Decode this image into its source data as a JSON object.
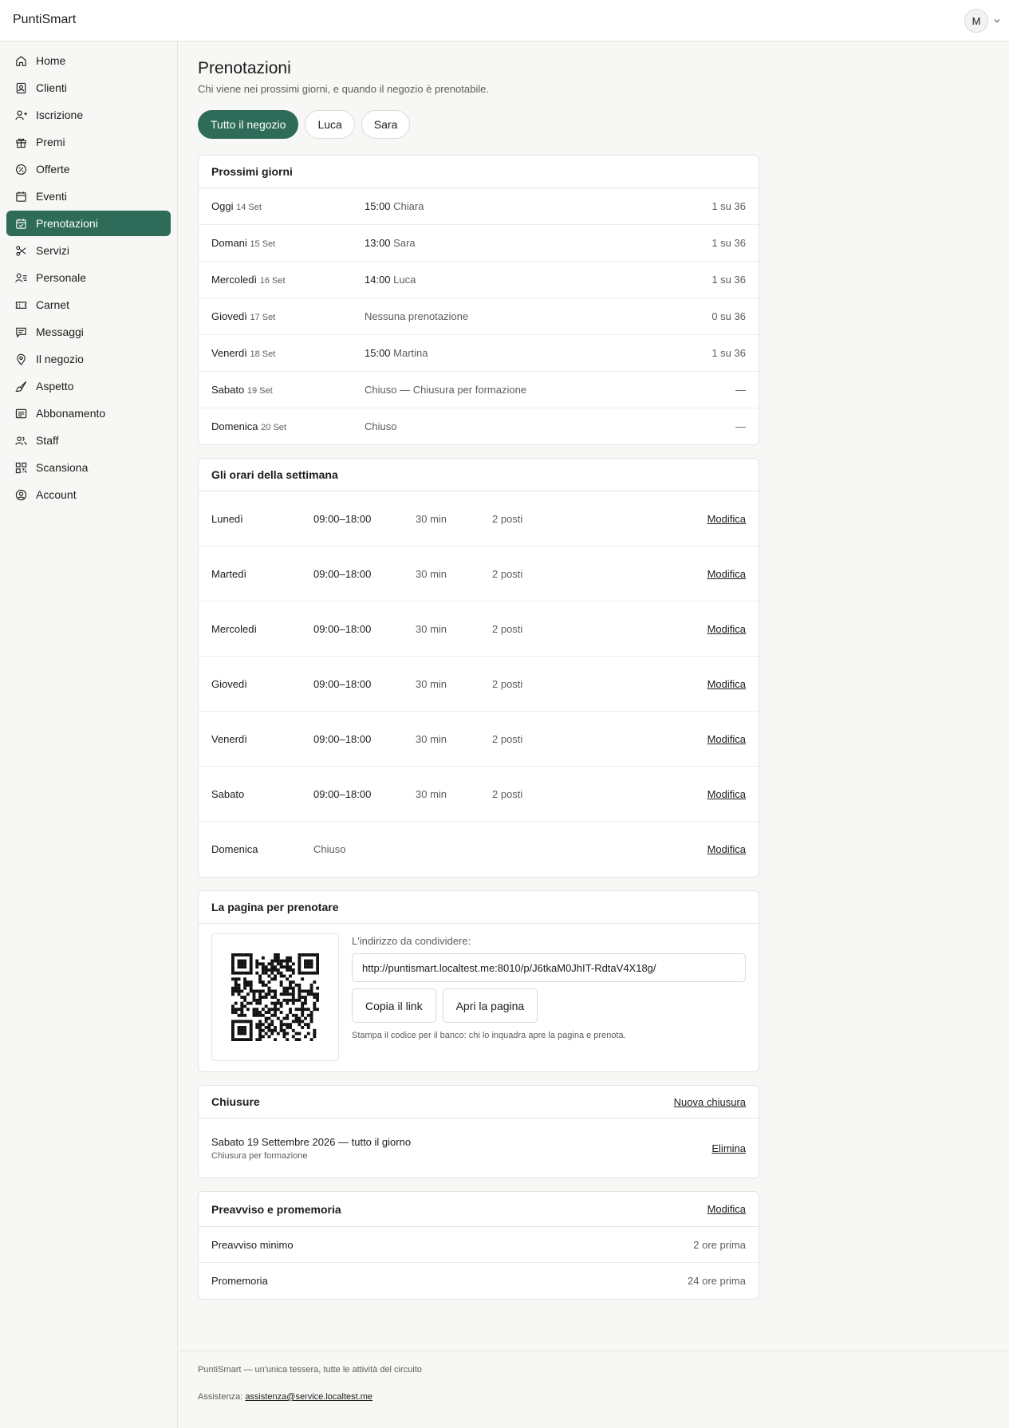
{
  "app": {
    "brand": "PuntiSmart",
    "avatar_initial": "M"
  },
  "sidebar": {
    "items": [
      {
        "label": "Home",
        "icon": "home-icon"
      },
      {
        "label": "Clienti",
        "icon": "contacts-icon"
      },
      {
        "label": "Iscrizione",
        "icon": "user-add-icon"
      },
      {
        "label": "Premi",
        "icon": "gift-icon"
      },
      {
        "label": "Offerte",
        "icon": "badge-percent-icon"
      },
      {
        "label": "Eventi",
        "icon": "calendar-icon"
      },
      {
        "label": "Prenotazioni",
        "icon": "calendar-check-icon",
        "active": true
      },
      {
        "label": "Servizi",
        "icon": "scissors-icon"
      },
      {
        "label": "Personale",
        "icon": "user-list-icon"
      },
      {
        "label": "Carnet",
        "icon": "ticket-icon"
      },
      {
        "label": "Messaggi",
        "icon": "message-icon"
      },
      {
        "label": "Il negozio",
        "icon": "map-pin-icon"
      },
      {
        "label": "Aspetto",
        "icon": "brush-icon"
      },
      {
        "label": "Abbonamento",
        "icon": "receipt-icon"
      },
      {
        "label": "Staff",
        "icon": "users-icon"
      },
      {
        "label": "Scansiona",
        "icon": "qr-scan-icon"
      },
      {
        "label": "Account",
        "icon": "user-circle-icon"
      }
    ]
  },
  "page": {
    "title": "Prenotazioni",
    "subtitle": "Chi viene nei prossimi giorni, e quando il negozio è prenotabile."
  },
  "tabs": [
    "Tutto il negozio",
    "Luca",
    "Sara"
  ],
  "upcoming": {
    "title": "Prossimi giorni",
    "rows": [
      {
        "day": "Oggi",
        "date": "14 Set",
        "time": "15:00",
        "info": "Chiara",
        "count": "1 su 36"
      },
      {
        "day": "Domani",
        "date": "15 Set",
        "time": "13:00",
        "info": "Sara",
        "count": "1 su 36"
      },
      {
        "day": "Mercoledì",
        "date": "16 Set",
        "time": "14:00",
        "info": "Luca",
        "count": "1 su 36"
      },
      {
        "day": "Giovedì",
        "date": "17 Set",
        "time": "",
        "info": "Nessuna prenotazione",
        "count": "0 su 36"
      },
      {
        "day": "Venerdì",
        "date": "18 Set",
        "time": "15:00",
        "info": "Martina",
        "count": "1 su 36"
      },
      {
        "day": "Sabato",
        "date": "19 Set",
        "time": "",
        "info": "Chiuso — Chiusura per formazione",
        "count": "—"
      },
      {
        "day": "Domenica",
        "date": "20 Set",
        "time": "",
        "info": "Chiuso",
        "count": "—"
      }
    ]
  },
  "weekly": {
    "title": "Gli orari della settimana",
    "edit_label": "Modifica",
    "rows": [
      {
        "day": "Lunedì",
        "hours": "09:00–18:00",
        "slot": "30 min",
        "seats": "2 posti"
      },
      {
        "day": "Martedì",
        "hours": "09:00–18:00",
        "slot": "30 min",
        "seats": "2 posti"
      },
      {
        "day": "Mercoledì",
        "hours": "09:00–18:00",
        "slot": "30 min",
        "seats": "2 posti"
      },
      {
        "day": "Giovedì",
        "hours": "09:00–18:00",
        "slot": "30 min",
        "seats": "2 posti"
      },
      {
        "day": "Venerdì",
        "hours": "09:00–18:00",
        "slot": "30 min",
        "seats": "2 posti"
      },
      {
        "day": "Sabato",
        "hours": "09:00–18:00",
        "slot": "30 min",
        "seats": "2 posti"
      },
      {
        "day": "Domenica",
        "hours": "Chiuso",
        "slot": "",
        "seats": ""
      }
    ]
  },
  "booking_page": {
    "title": "La pagina per prenotare",
    "share_label": "L'indirizzo da condividere:",
    "url": "http://puntismart.localtest.me:8010/p/J6tkaM0JhIT-RdtaV4X18g/",
    "copy_label": "Copia il link",
    "open_label": "Apri la pagina",
    "hint": "Stampa il codice per il banco: chi lo inquadra apre la pagina e prenota."
  },
  "closures": {
    "title": "Chiusure",
    "new_label": "Nuova chiusura",
    "items": [
      {
        "title": "Sabato 19 Settembre 2026 — tutto il giorno",
        "note": "Chiusura per formazione",
        "delete_label": "Elimina"
      }
    ]
  },
  "notice": {
    "title": "Preavviso e promemoria",
    "edit_label": "Modifica",
    "rows": [
      {
        "label": "Preavviso minimo",
        "value": "2 ore prima"
      },
      {
        "label": "Promemoria",
        "value": "24 ore prima"
      }
    ]
  },
  "footer": {
    "tagline": "PuntiSmart — un'unica tessera, tutte le attività del circuito",
    "support_label": "Assistenza:",
    "support_email": "assistenza@service.localtest.me"
  },
  "colors": {
    "accent": "#2e6b58",
    "text": "#1c1c1a",
    "muted": "#5d5d59",
    "border": "#e4e4e1"
  }
}
